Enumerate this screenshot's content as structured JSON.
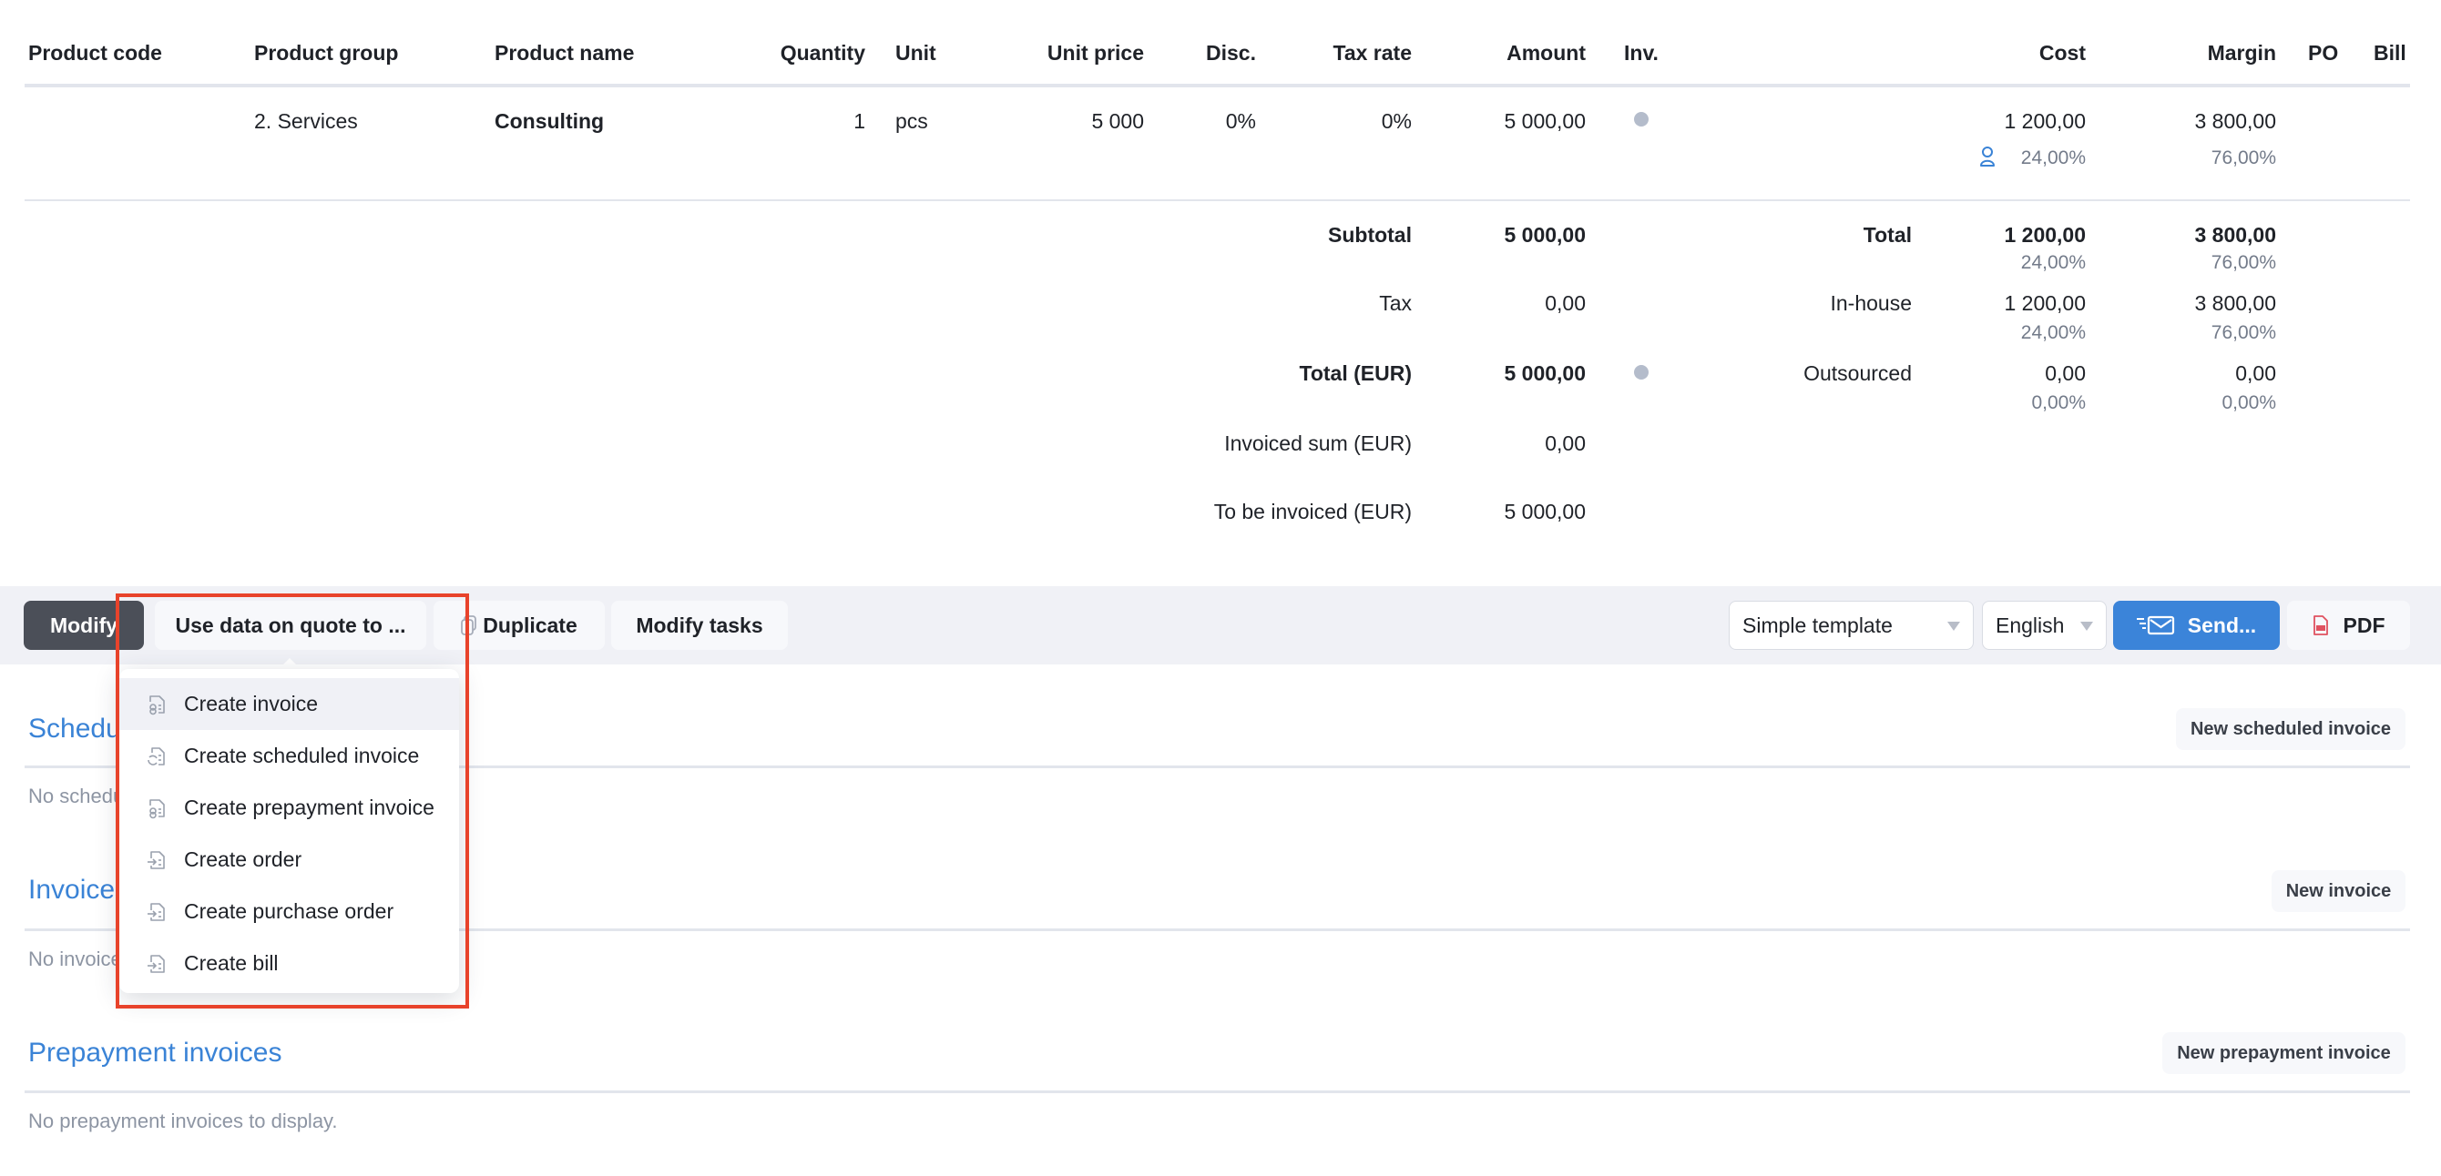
{
  "table": {
    "headers": {
      "product_code": "Product code",
      "product_group": "Product group",
      "product_name": "Product name",
      "quantity": "Quantity",
      "unit": "Unit",
      "unit_price": "Unit price",
      "disc": "Disc.",
      "tax_rate": "Tax rate",
      "amount": "Amount",
      "inv": "Inv.",
      "cost": "Cost",
      "margin": "Margin",
      "po": "PO",
      "bill": "Bill"
    },
    "rows": [
      {
        "product_code": "",
        "product_group": "2. Services",
        "product_name": "Consulting",
        "quantity": "1",
        "unit": "pcs",
        "unit_price": "5 000",
        "disc": "0%",
        "tax_rate": "0%",
        "amount": "5 000,00",
        "inv_status": "pending",
        "cost": "1 200,00",
        "cost_pct": "24,00%",
        "cost_icon": "person-icon",
        "margin": "3 800,00",
        "margin_pct": "76,00%"
      }
    ]
  },
  "totals": {
    "subtotal_label": "Subtotal",
    "subtotal_value": "5 000,00",
    "tax_label": "Tax",
    "tax_value": "0,00",
    "total_label": "Total (EUR)",
    "total_value": "5 000,00",
    "invoiced_label": "Invoiced sum (EUR)",
    "invoiced_value": "0,00",
    "to_invoice_label": "To be invoiced (EUR)",
    "to_invoice_value": "5 000,00"
  },
  "cost_summary": {
    "total": {
      "label": "Total",
      "cost": "1 200,00",
      "cost_pct": "24,00%",
      "margin": "3 800,00",
      "margin_pct": "76,00%"
    },
    "inhouse": {
      "label": "In-house",
      "cost": "1 200,00",
      "cost_pct": "24,00%",
      "margin": "3 800,00",
      "margin_pct": "76,00%"
    },
    "outsourced": {
      "label": "Outsourced",
      "cost": "0,00",
      "cost_pct": "0,00%",
      "margin": "0,00",
      "margin_pct": "0,00%"
    }
  },
  "toolbar": {
    "modify": "Modify",
    "use_data": "Use data on quote to ...",
    "duplicate": "Duplicate",
    "modify_tasks": "Modify tasks",
    "template_select": "Simple template",
    "language_select": "English",
    "send": "Send...",
    "pdf": "PDF"
  },
  "dropdown": {
    "items": [
      {
        "label": "Create invoice",
        "icon": "invoice-icon",
        "highlighted": true
      },
      {
        "label": "Create scheduled invoice",
        "icon": "scheduled-invoice-icon",
        "highlighted": false
      },
      {
        "label": "Create prepayment invoice",
        "icon": "invoice-icon",
        "highlighted": false
      },
      {
        "label": "Create order",
        "icon": "document-import-icon",
        "highlighted": false
      },
      {
        "label": "Create purchase order",
        "icon": "document-import-icon",
        "highlighted": false
      },
      {
        "label": "Create bill",
        "icon": "document-import-icon",
        "highlighted": false
      }
    ]
  },
  "sections": {
    "scheduled": {
      "title": "Scheduled invoices",
      "empty": "No scheduled invoices to display.",
      "button": "New scheduled invoice"
    },
    "invoices": {
      "title": "Invoices",
      "empty": "No invoices to display.",
      "button": "New invoice"
    },
    "prepayment": {
      "title": "Prepayment invoices",
      "empty": "No prepayment invoices to display.",
      "button": "New prepayment invoice"
    }
  },
  "colors": {
    "accent": "#3a83d6",
    "send_button": "#3b84d9",
    "modify_button": "#4b4f58",
    "highlight_box": "#e8432b",
    "status_dot": "#b4bccb"
  }
}
